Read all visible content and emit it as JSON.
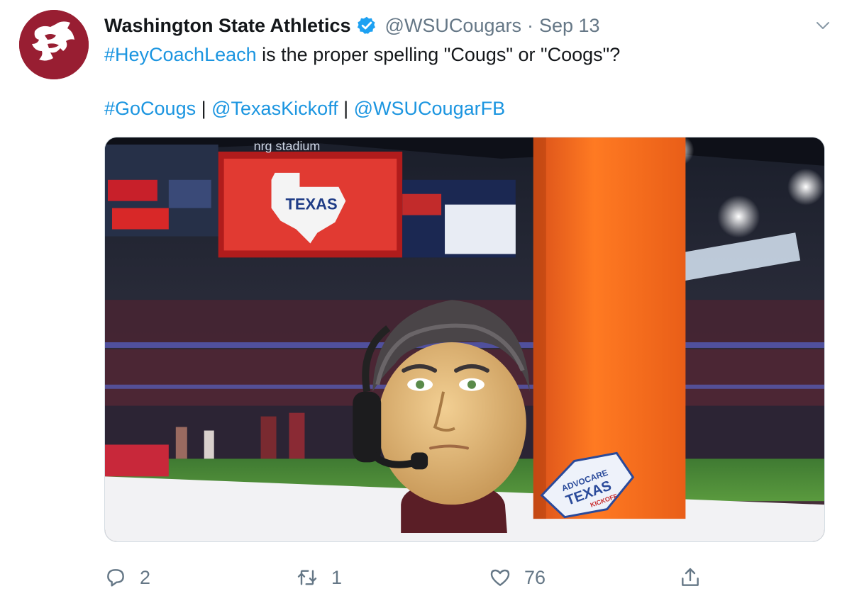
{
  "tweet": {
    "author": {
      "display_name": "Washington State Athletics",
      "handle": "@WSUCougars",
      "verified": true,
      "avatar_icon": "wsu-cougar-logo-icon",
      "avatar_color": "#981e32"
    },
    "separator": "·",
    "timestamp": "Sep 13",
    "text": {
      "hashtag_1": "#HeyCoachLeach",
      "body": " is the proper spelling \"Cougs\" or \"Coogs\"?",
      "line2": [
        {
          "text": "#GoCougs",
          "type": "link"
        },
        {
          "text": " | ",
          "type": "plain"
        },
        {
          "text": "@TexasKickoff",
          "type": "link"
        },
        {
          "text": " | ",
          "type": "plain"
        },
        {
          "text": "@WSUCougarFB",
          "type": "link"
        }
      ]
    },
    "media": {
      "type": "photo",
      "scoreboard_text": "nrg stadium",
      "board_text": "TEXAS",
      "sticker_text": [
        "ADVOCARE",
        "TEXAS",
        "KICKOFF"
      ]
    },
    "actions": {
      "reply_count": "2",
      "retweet_count": "1",
      "like_count": "76"
    },
    "colors": {
      "link": "#1b95e0",
      "verified": "#1da1f2",
      "muted": "#657786"
    }
  }
}
